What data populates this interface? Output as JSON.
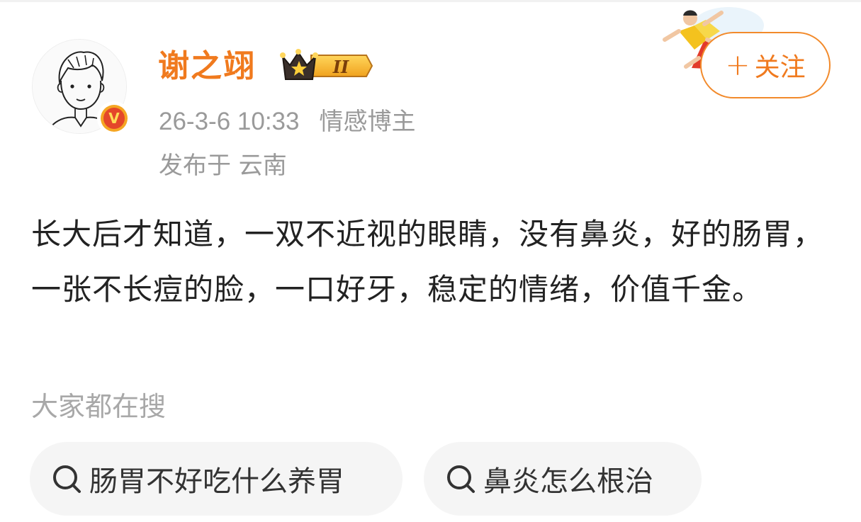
{
  "user": {
    "name": "谢之翊",
    "level": "II",
    "timestamp": "26-3-6 10:33",
    "tag": "情感博主",
    "location": "发布于 云南",
    "verified_badge": "V"
  },
  "follow_button": {
    "label": "关注",
    "icon": "plus-icon"
  },
  "post": {
    "text": "长大后才知道，一双不近视的眼睛，没有鼻炎，好的肠胃，一张不长痘的脸，一口好牙，稳定的情绪，价值千金。"
  },
  "search": {
    "title": "大家都在搜",
    "items": [
      {
        "label": "肠胃不好吃什么养胃",
        "icon": "search-icon"
      },
      {
        "label": "鼻炎怎么根治",
        "icon": "search-icon"
      }
    ]
  },
  "colors": {
    "accent": "#f07a1e",
    "muted": "#9a9a9a",
    "text": "#222222",
    "pill_bg": "#f5f5f5"
  }
}
